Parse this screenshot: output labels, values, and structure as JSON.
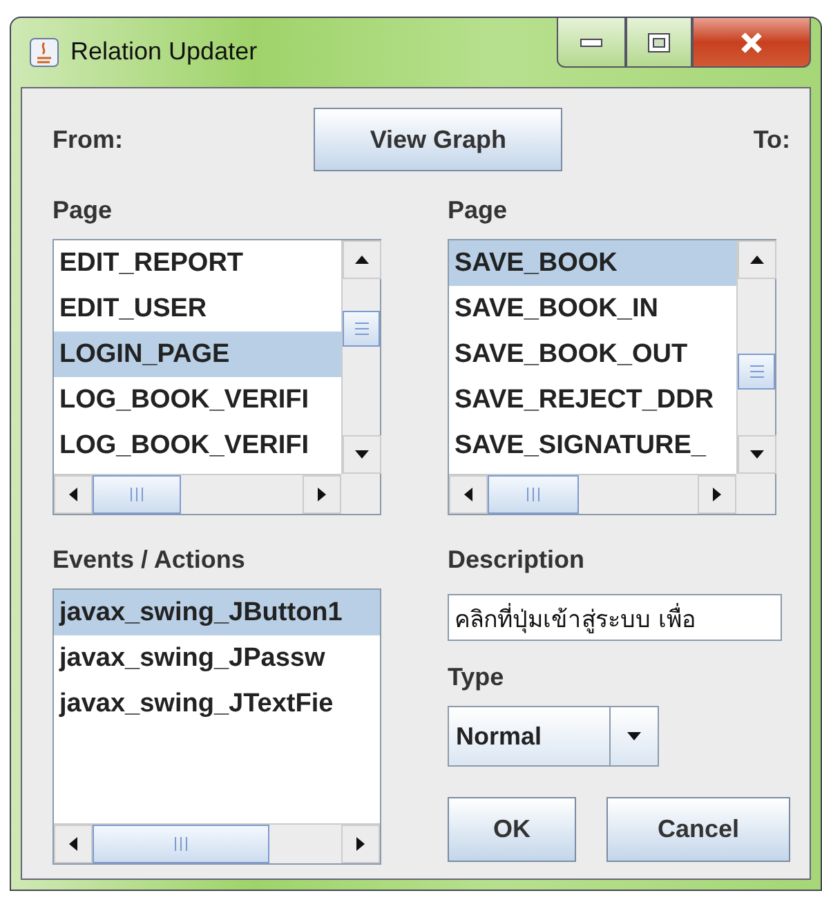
{
  "window": {
    "title": "Relation Updater"
  },
  "from_label": "From:",
  "view_graph_button": "View Graph",
  "to_label": "To:",
  "from_page": {
    "label": "Page",
    "items": [
      {
        "text": "EDIT_REPORT",
        "selected": false
      },
      {
        "text": "EDIT_USER",
        "selected": false
      },
      {
        "text": "LOGIN_PAGE",
        "selected": true
      },
      {
        "text": "LOG_BOOK_VERIFI",
        "selected": false
      },
      {
        "text": "LOG_BOOK_VERIFI",
        "selected": false
      }
    ]
  },
  "to_page": {
    "label": "Page",
    "items": [
      {
        "text": "SAVE_BOOK",
        "selected": true
      },
      {
        "text": "SAVE_BOOK_IN",
        "selected": false
      },
      {
        "text": "SAVE_BOOK_OUT",
        "selected": false
      },
      {
        "text": "SAVE_REJECT_DDR",
        "selected": false
      },
      {
        "text": "SAVE_SIGNATURE_",
        "selected": false
      }
    ]
  },
  "events": {
    "label": "Events / Actions",
    "items": [
      {
        "text": "javax_swing_JButton1",
        "selected": true
      },
      {
        "text": "javax_swing_JPassw",
        "selected": false
      },
      {
        "text": "javax_swing_JTextFie",
        "selected": false
      }
    ]
  },
  "description": {
    "label": "Description",
    "value": "คลิกที่ปุ่มเข้าสู่ระบบ เพื่อ"
  },
  "type": {
    "label": "Type",
    "value": "Normal"
  },
  "buttons": [
    "OK",
    "Cancel"
  ]
}
